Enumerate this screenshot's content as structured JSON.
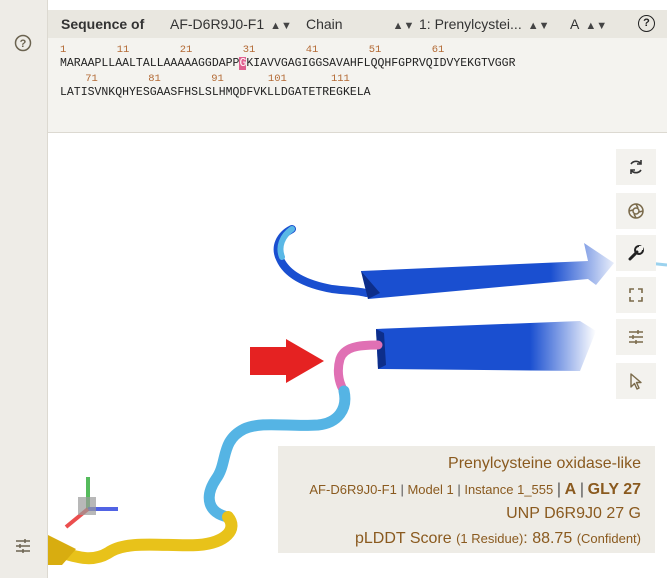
{
  "header": {
    "title": "Sequence of",
    "entry_select": "AF-D6R9J0-F1",
    "mode_select": "Chain",
    "entity_select": "1: Prenylcystei...",
    "chain_select": "A",
    "help_icon": "help-circle-icon"
  },
  "sequence": {
    "line1_numbers": "1        11        21        31        41        51        61",
    "line1_before": "MARAAPLLAALTALLAAAAAGGDAPP",
    "line1_highlight": "G",
    "line1_after": "KIAVVGAGIGGSAVAHFLQQHFGPRVQIDVYEKGTVGGR",
    "line2_numbers": "    71        81        91       101       111",
    "line2_text": "LATISVNKQHYESGAASFHSLSLHMQDFVKLLDGATETREGKELA"
  },
  "toolbar": {
    "reset_icon": "reset-camera-icon",
    "screenshot_icon": "camera-shutter-icon",
    "settings_icon": "wrench-icon",
    "fullscreen_icon": "fullscreen-icon",
    "controls_icon": "sliders-icon",
    "select_icon": "cursor-arrow-icon"
  },
  "info": {
    "protein_name": "Prenylcysteine oxidase-like",
    "entry": "AF-D6R9J0-F1",
    "model": "Model 1",
    "instance": "Instance 1_555",
    "chain": "A",
    "residue": "GLY 27",
    "unp": "UNP D6R9J0 27 G",
    "plddt_label": "pLDDT Score",
    "plddt_count": "(1 Residue)",
    "plddt_value": "88.75",
    "plddt_conf": "(Confident)"
  },
  "colors": {
    "panel_bg": "#f4f3ef",
    "header_bg": "#e9e7e0",
    "accent_text": "#8a5a1f",
    "highlight": "#e06090",
    "strand_blue": "#1a4fd0",
    "coil_light_blue": "#55b4e4",
    "coil_yellow": "#e8c21a",
    "arrow_red": "#e52222"
  }
}
